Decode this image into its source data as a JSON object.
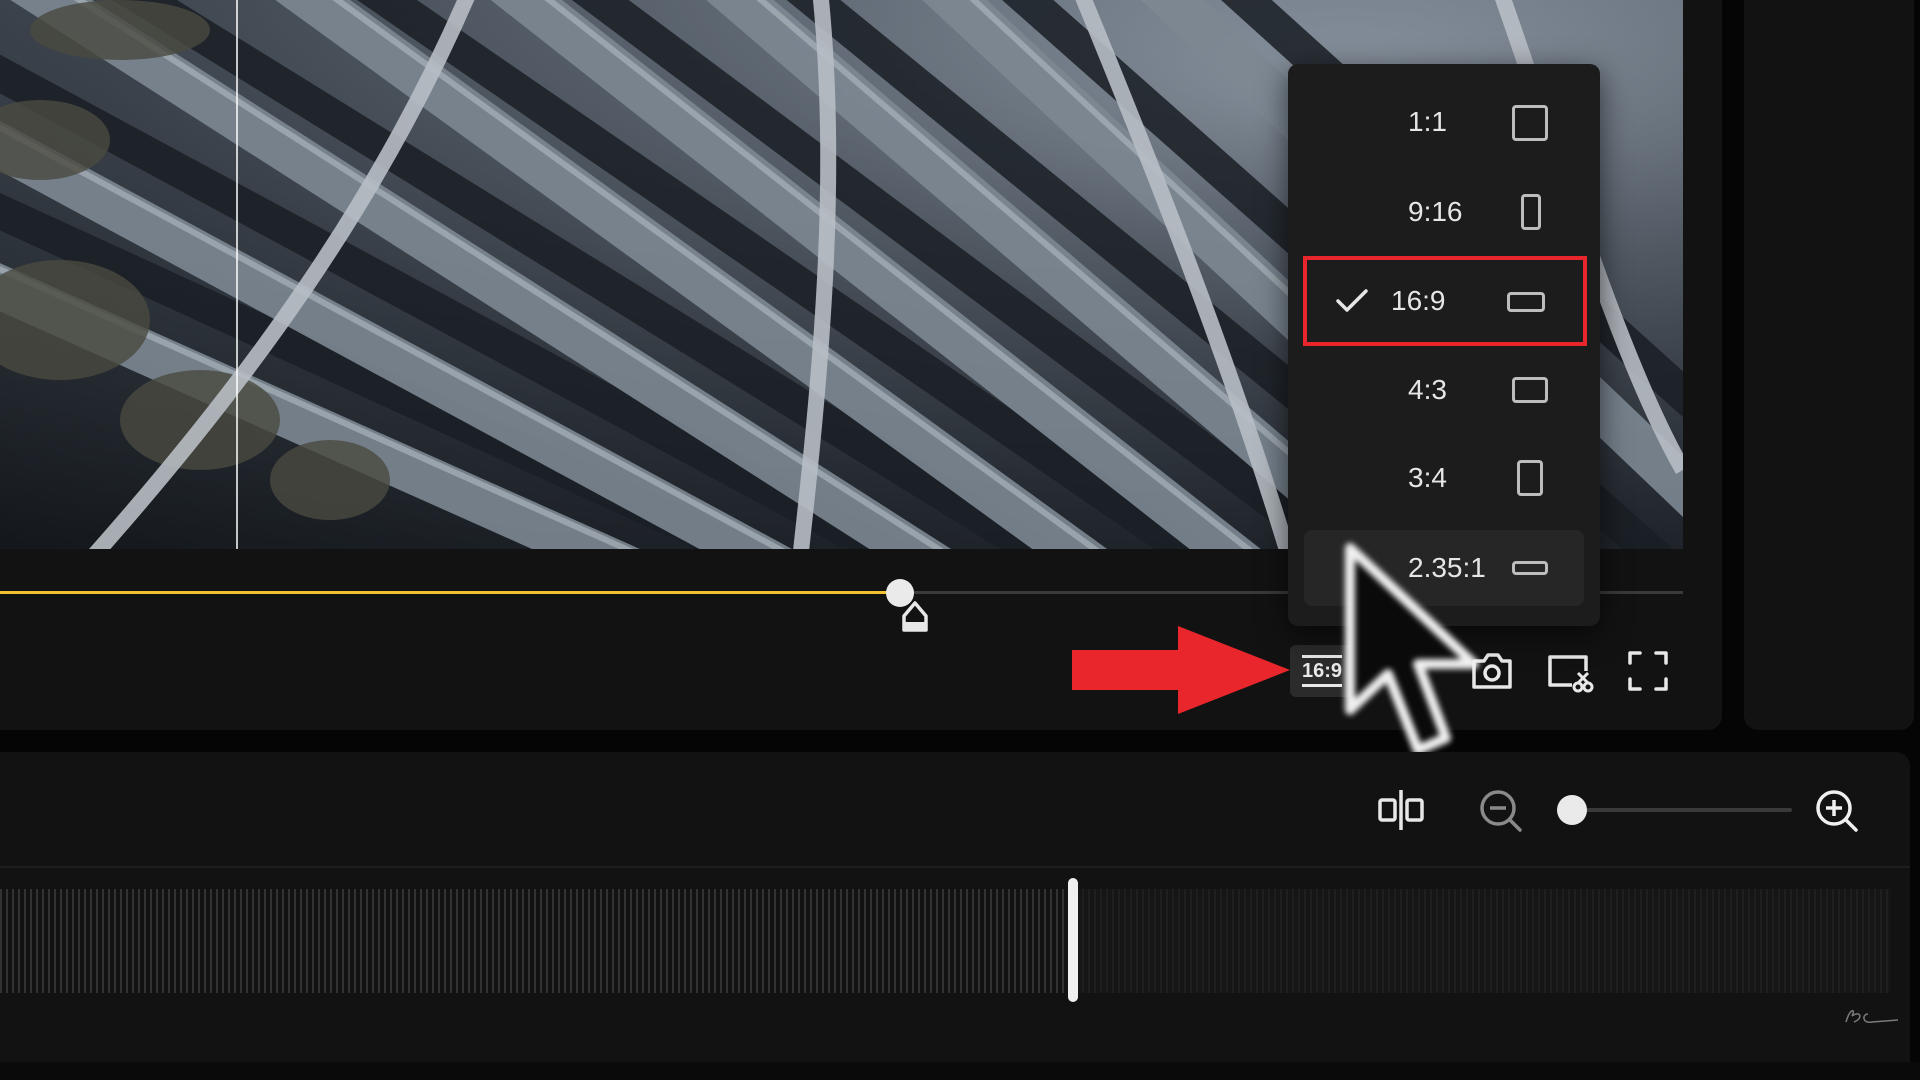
{
  "player": {
    "progress_fraction": 0.535,
    "progress_color": "#f2c230",
    "aspect_button_label": "16:9"
  },
  "aspect_menu": {
    "items": [
      {
        "label": "1:1",
        "icon": "square-ratio-icon"
      },
      {
        "label": "9:16",
        "icon": "portrait-ratio-icon"
      },
      {
        "label": "16:9",
        "icon": "landscape-ratio-icon",
        "selected": true
      },
      {
        "label": "4:3",
        "icon": "landscape-ratio-icon"
      },
      {
        "label": "3:4",
        "icon": "portrait-ratio-icon"
      },
      {
        "label": "2.35:1",
        "icon": "wide-ratio-icon"
      }
    ],
    "highlight_color": "#e8262b"
  },
  "toolbar": {
    "icons": [
      "aspect-ratio-button",
      "snapshot-icon",
      "crop-cut-icon",
      "fullscreen-icon"
    ]
  },
  "timeline": {
    "zoom_fraction": 0.05,
    "icons": [
      "split-icon",
      "zoom-out-icon",
      "zoom-in-icon"
    ]
  },
  "annotation": {
    "arrow_color": "#e8262b"
  }
}
